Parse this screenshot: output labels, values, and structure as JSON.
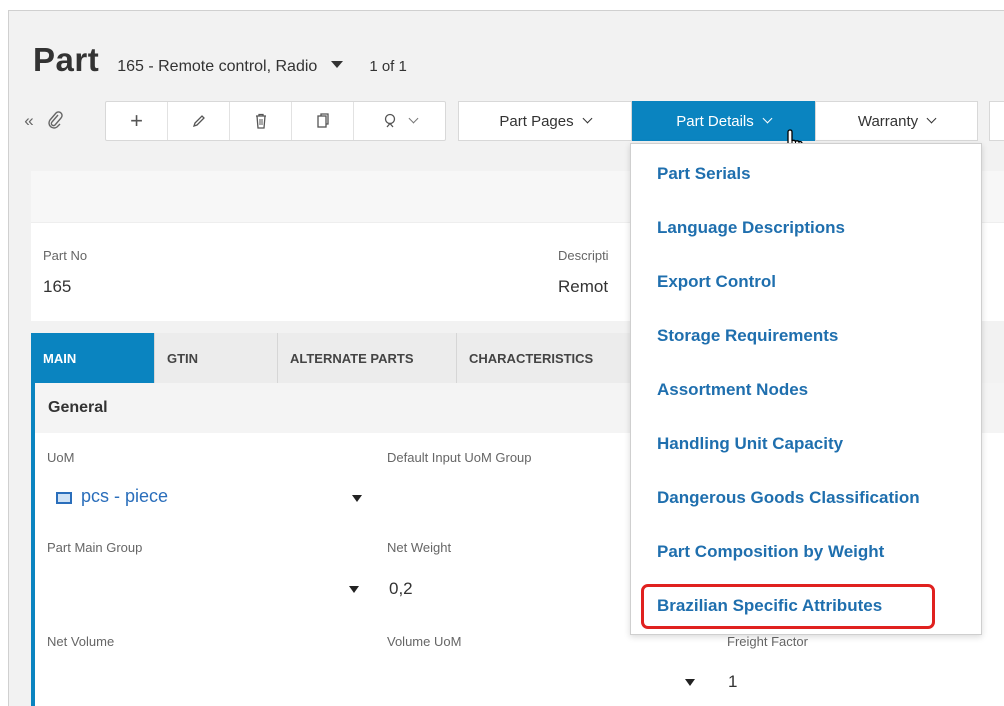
{
  "header": {
    "title": "Part",
    "record_label": "165 - Remote control, Radio",
    "record_count": "1 of 1"
  },
  "toolbar": {
    "icons": [
      "collapse-icon",
      "attachment-icon",
      "add-icon",
      "edit-icon",
      "delete-icon",
      "copy-icon",
      "search-filter-icon"
    ],
    "add_symbol": "+",
    "nav": {
      "part_pages": "Part Pages",
      "part_details": "Part Details",
      "warranty": "Warranty"
    }
  },
  "summary": {
    "part_no_label": "Part No",
    "part_no_value": "165",
    "description_label": "Descripti",
    "description_value": "Remot"
  },
  "tabs": [
    {
      "label": "MAIN",
      "active": true
    },
    {
      "label": "GTIN",
      "active": false
    },
    {
      "label": "ALTERNATE PARTS",
      "active": false
    },
    {
      "label": "CHARACTERISTICS",
      "active": false
    }
  ],
  "main": {
    "section_title": "General",
    "uom_label": "UoM",
    "uom_value": "pcs - piece",
    "default_input_uom_group_label": "Default Input UoM Group",
    "part_main_group_label": "Part Main Group",
    "net_weight_label": "Net Weight",
    "net_weight_value": "0,2",
    "net_volume_label": "Net Volume",
    "volume_uom_label": "Volume UoM",
    "freight_factor_label": "Freight Factor",
    "freight_factor_value": "1"
  },
  "dropdown_menu": {
    "items": [
      "Part Serials",
      "Language Descriptions",
      "Export Control",
      "Storage Requirements",
      "Assortment Nodes",
      "Handling Unit Capacity",
      "Dangerous Goods Classification",
      "Part Composition by Weight",
      "Brazilian Specific Attributes"
    ],
    "highlighted_item": "Brazilian Specific Attributes"
  },
  "colors": {
    "accent": "#0a84c0",
    "link": "#1f6fae",
    "highlight_border": "#e0211f"
  }
}
